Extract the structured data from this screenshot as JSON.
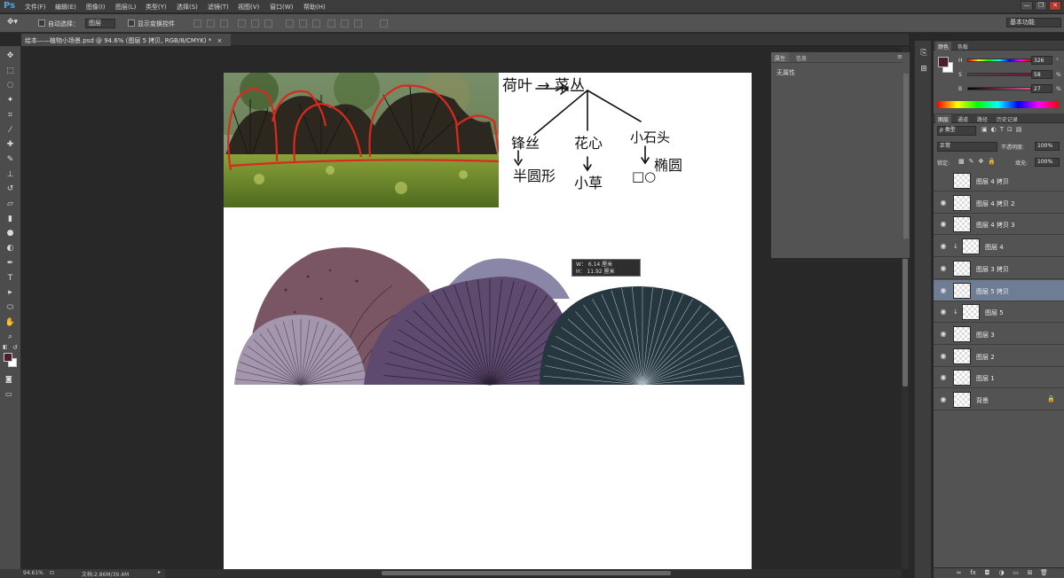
{
  "app": {
    "logo": "Ps"
  },
  "menu": [
    "文件(F)",
    "编辑(E)",
    "图像(I)",
    "图层(L)",
    "类型(Y)",
    "选择(S)",
    "滤镜(T)",
    "视图(V)",
    "窗口(W)",
    "帮助(H)"
  ],
  "window_controls": [
    "—",
    "❐",
    "✕"
  ],
  "options": {
    "auto_select_label": "自动选择：",
    "auto_select_value": "图层",
    "show_transform_label": "显示变换控件",
    "workspace": "基本功能"
  },
  "document": {
    "tab_title": "绘本——植物小场景.psd @ 94.6% (图层 5 拷贝, RGB/8/CMYK) *",
    "tab_close": "×"
  },
  "tools": [
    {
      "icon": "move-tool-icon",
      "glyph": "✥"
    },
    {
      "icon": "marquee-tool-icon",
      "glyph": "⬚"
    },
    {
      "icon": "lasso-tool-icon",
      "glyph": "◌"
    },
    {
      "icon": "quick-select-tool-icon",
      "glyph": "✦"
    },
    {
      "icon": "crop-tool-icon",
      "glyph": "⌗"
    },
    {
      "icon": "eyedropper-tool-icon",
      "glyph": "⁄"
    },
    {
      "icon": "healing-brush-tool-icon",
      "glyph": "✚"
    },
    {
      "icon": "brush-tool-icon",
      "glyph": "✎"
    },
    {
      "icon": "clone-stamp-tool-icon",
      "glyph": "⊥"
    },
    {
      "icon": "history-brush-tool-icon",
      "glyph": "↺"
    },
    {
      "icon": "eraser-tool-icon",
      "glyph": "▱"
    },
    {
      "icon": "gradient-tool-icon",
      "glyph": "▮"
    },
    {
      "icon": "blur-tool-icon",
      "glyph": "●"
    },
    {
      "icon": "dodge-tool-icon",
      "glyph": "◐"
    },
    {
      "icon": "pen-tool-icon",
      "glyph": "✒"
    },
    {
      "icon": "type-tool-icon",
      "glyph": "T"
    },
    {
      "icon": "path-select-tool-icon",
      "glyph": "▸"
    },
    {
      "icon": "shape-tool-icon",
      "glyph": "⬭"
    },
    {
      "icon": "hand-tool-icon",
      "glyph": "✋"
    },
    {
      "icon": "zoom-tool-icon",
      "glyph": "⌕"
    }
  ],
  "foreground_color": "#4a1e2e",
  "background_color": "#ffffff",
  "tooltip": {
    "line1": "W： 6.14 厘米",
    "line2": "H： 11.92 厘米"
  },
  "sketch_notes": [
    "荷叶 → 菜丛",
    "锋丝",
    "花心",
    "小石头",
    "半圆形",
    "小草",
    "□○",
    "椭圆"
  ],
  "status": {
    "zoom": "94.61%",
    "doc_info": "文档:2.86M/39.4M"
  },
  "props_panel": {
    "tabs": [
      "属性",
      "信息"
    ],
    "body": "无属性"
  },
  "color_panel": {
    "tabs": [
      "颜色",
      "色板"
    ],
    "h": {
      "label": "H",
      "value": "326",
      "unit": "°"
    },
    "s": {
      "label": "S",
      "value": "58",
      "unit": "%"
    },
    "b": {
      "label": "B",
      "value": "27",
      "unit": "%"
    }
  },
  "layers_panel": {
    "tabs": [
      "图层",
      "通道",
      "路径",
      "历史记录"
    ],
    "filter": "ρ 类型",
    "blend_mode": "正常",
    "opacity_label": "不透明度:",
    "opacity": "100%",
    "lock_label": "锁定:",
    "fill_label": "填充:",
    "fill": "100%",
    "layers": [
      {
        "name": "图层 4 拷贝",
        "visible": false,
        "selected": false,
        "clipped": false,
        "locked": false
      },
      {
        "name": "图层 4 拷贝 2",
        "visible": true,
        "selected": false,
        "clipped": false,
        "locked": false
      },
      {
        "name": "图层 4 拷贝 3",
        "visible": true,
        "selected": false,
        "clipped": false,
        "locked": false
      },
      {
        "name": "图层 4",
        "visible": true,
        "selected": false,
        "clipped": true,
        "locked": false
      },
      {
        "name": "图层 3 拷贝",
        "visible": true,
        "selected": false,
        "clipped": false,
        "locked": false
      },
      {
        "name": "图层 5 拷贝",
        "visible": true,
        "selected": true,
        "clipped": false,
        "locked": false
      },
      {
        "name": "图层 5",
        "visible": true,
        "selected": false,
        "clipped": true,
        "locked": false
      },
      {
        "name": "图层 3",
        "visible": true,
        "selected": false,
        "clipped": false,
        "locked": false
      },
      {
        "name": "图层 2",
        "visible": true,
        "selected": false,
        "clipped": false,
        "locked": false
      },
      {
        "name": "图层 1",
        "visible": true,
        "selected": false,
        "clipped": false,
        "locked": false
      },
      {
        "name": "背景",
        "visible": true,
        "selected": false,
        "clipped": false,
        "locked": true
      }
    ]
  }
}
